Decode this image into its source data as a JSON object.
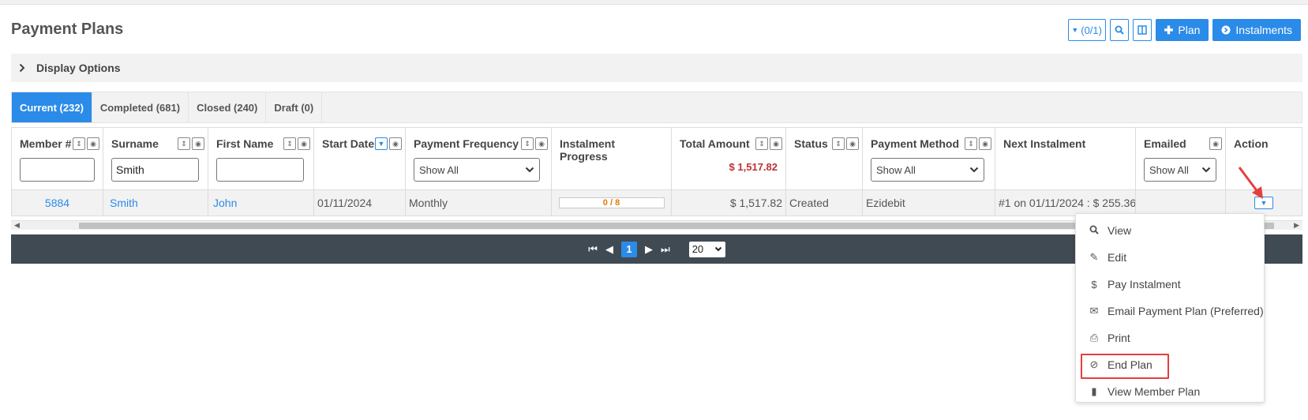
{
  "page": {
    "title": "Payment Plans"
  },
  "toolbar": {
    "filter_button": "(0/1)",
    "plan_button": "Plan",
    "instalments_button": "Instalments",
    "icons": {
      "filter": "caret-down-icon",
      "search": "search-icon",
      "columns": "columns-icon",
      "plus": "plus-icon",
      "arrow": "arrow-circle-right-icon"
    }
  },
  "display_options": {
    "label": "Display Options"
  },
  "tabs": [
    {
      "label": "Current (232)",
      "active": true
    },
    {
      "label": "Completed (681)",
      "active": false
    },
    {
      "label": "Closed (240)",
      "active": false
    },
    {
      "label": "Draft (0)",
      "active": false
    }
  ],
  "columns": {
    "member": "Member #",
    "surname": "Surname",
    "first_name": "First Name",
    "start_date": "Start Date",
    "payment_frequency": "Payment Frequency",
    "instalment_progress": "Instalment Progress",
    "total_amount": "Total Amount",
    "status": "Status",
    "payment_method": "Payment Method",
    "next_instalment": "Next Instalment",
    "emailed": "Emailed",
    "action": "Action"
  },
  "filters": {
    "member": "",
    "surname": "Smith",
    "first_name": "",
    "payment_frequency": "Show All",
    "payment_method": "Show All",
    "emailed": "Show All",
    "total_sum": "$ 1,517.82"
  },
  "rows": [
    {
      "member": "5884",
      "surname": "Smith",
      "first_name": "John",
      "start_date": "01/11/2024",
      "payment_frequency": "Monthly",
      "progress": "0 / 8",
      "progress_fraction": 0,
      "total_amount": "$ 1,517.82",
      "status": "Created",
      "payment_method": "Ezidebit",
      "next_instalment": "#1 on 01/11/2024 : $ 255.36",
      "emailed": ""
    }
  ],
  "pager": {
    "current_page": "1",
    "page_size": "20"
  },
  "menu": {
    "items": [
      {
        "label": "View",
        "icon": "search-icon"
      },
      {
        "label": "Edit",
        "icon": "pencil-icon"
      },
      {
        "label": "Pay Instalment",
        "icon": "dollar-icon"
      },
      {
        "label": "Email Payment Plan (Preferred)",
        "icon": "envelope-icon"
      },
      {
        "label": "Print",
        "icon": "print-icon"
      },
      {
        "label": "End Plan",
        "icon": "ban-icon"
      },
      {
        "label": "View Member Plan",
        "icon": "file-icon"
      }
    ]
  },
  "colors": {
    "accent": "#2b8be8",
    "highlight": "#e53e3e",
    "pager_bg": "#404a52",
    "progress_text": "#e07b00",
    "total_text": "#b33333"
  }
}
